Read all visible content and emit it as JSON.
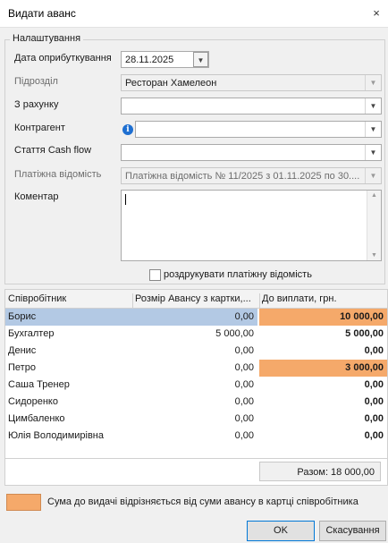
{
  "window": {
    "title": "Видати аванс",
    "close_glyph": "×"
  },
  "settings": {
    "group_label": "Налаштування",
    "date_label": "Дата оприбуткування",
    "date_value": "28.11.2025",
    "division_label": "Підрозділ",
    "division_value": "Ресторан Хамелеон",
    "account_label": "З рахунку",
    "account_value": "",
    "counterparty_label": "Контрагент",
    "counterparty_value": "",
    "cashflow_label": "Стаття Cash flow",
    "cashflow_value": "",
    "payroll_label": "Платіжна відомість",
    "payroll_value": "Платіжна відомість № 11/2025 з 01.11.2025 по 30....",
    "comment_label": "Коментар",
    "comment_value": "",
    "print_label": "роздрукувати платіжну відомість",
    "print_checked": false
  },
  "table": {
    "headers": [
      "Співробітник",
      "Розмір Авансу з картки,...",
      "До виплати, грн."
    ],
    "rows": [
      {
        "name": "Борис",
        "advance": "0,00",
        "pay": "10 000,00",
        "selected": true,
        "highlight": true
      },
      {
        "name": "Бухгалтер",
        "advance": "5 000,00",
        "pay": "5 000,00",
        "selected": false,
        "highlight": false
      },
      {
        "name": "Денис",
        "advance": "0,00",
        "pay": "0,00",
        "selected": false,
        "highlight": false
      },
      {
        "name": "Петро",
        "advance": "0,00",
        "pay": "3 000,00",
        "selected": false,
        "highlight": true
      },
      {
        "name": "Саша Тренер",
        "advance": "0,00",
        "pay": "0,00",
        "selected": false,
        "highlight": false
      },
      {
        "name": "Сидоренко",
        "advance": "0,00",
        "pay": "0,00",
        "selected": false,
        "highlight": false
      },
      {
        "name": "Цимбаленко",
        "advance": "0,00",
        "pay": "0,00",
        "selected": false,
        "highlight": false
      },
      {
        "name": "Юлія Володимирівна",
        "advance": "0,00",
        "pay": "0,00",
        "selected": false,
        "highlight": false
      }
    ],
    "total": "Разом: 18 000,00"
  },
  "legend": {
    "text": "Сума до видачі відрізняється від суми авансу в картці співробітника",
    "color": "#f5a96a"
  },
  "buttons": {
    "ok": "OK",
    "cancel": "Скасування"
  },
  "icons": {
    "close": "close-icon",
    "info": "info-icon",
    "dropdown": "chevron-down-icon"
  }
}
